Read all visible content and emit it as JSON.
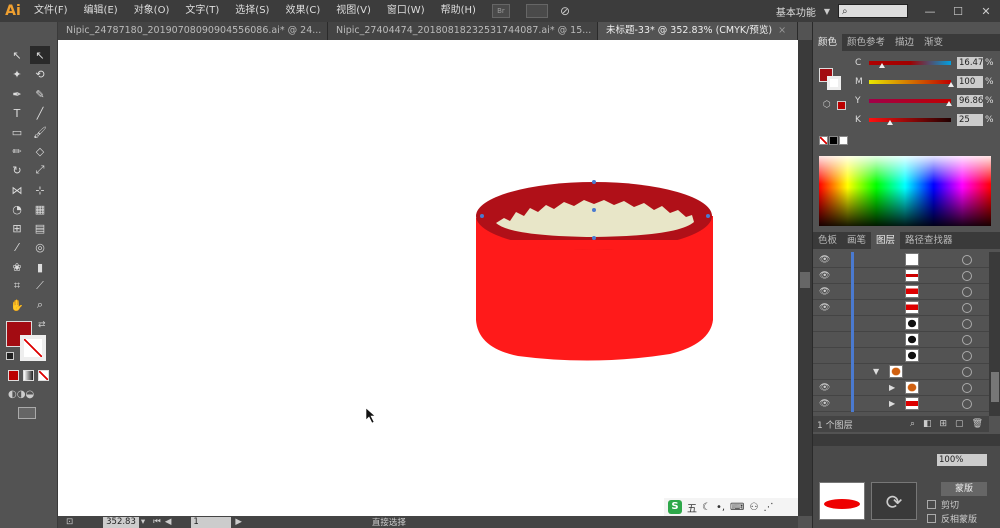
{
  "app": {
    "logo": "Ai"
  },
  "menu": {
    "items": [
      "文件(F)",
      "编辑(E)",
      "对象(O)",
      "文字(T)",
      "选择(S)",
      "效果(C)",
      "视图(V)",
      "窗口(W)",
      "帮助(H)"
    ],
    "br_label": "Br",
    "workspace": "基本功能",
    "search_placeholder": "",
    "search_icon": "search-icon"
  },
  "tabs": [
    {
      "label": "Nipic_24787180_20190708090904556086.ai* @ 24...",
      "active": false
    },
    {
      "label": "Nipic_27404474_20180818232531744087.ai* @ 15...",
      "active": false
    },
    {
      "label": "未标题-33* @ 352.83% (CMYK/预览)",
      "active": true
    }
  ],
  "status": {
    "zoom": "352.83",
    "page": "1",
    "tool_text": "直接选择"
  },
  "color_panel": {
    "tabs": [
      "颜色",
      "颜色参考",
      "描边",
      "渐变"
    ],
    "channels": [
      {
        "label": "C",
        "value": "16.47",
        "fraction": 0.16,
        "gradient": "linear-gradient(to right,#b00000,#a00000,#00a0e0)"
      },
      {
        "label": "M",
        "value": "100",
        "fraction": 1.0,
        "gradient": "linear-gradient(to right,#e8e800,#c00000)"
      },
      {
        "label": "Y",
        "value": "96.86",
        "fraction": 0.97,
        "gradient": "linear-gradient(to right,#a0004a,#c00000)"
      },
      {
        "label": "K",
        "value": "25",
        "fraction": 0.25,
        "gradient": "linear-gradient(to right,#ff1010,#200000)"
      }
    ],
    "fill_color": "#a30c12"
  },
  "layers_panel": {
    "tabs": [
      "色板",
      "画笔",
      "图层",
      "路径查找器"
    ],
    "footer": "1 个图层",
    "rows": [
      {
        "eye": true,
        "thumb": "white"
      },
      {
        "eye": true,
        "thumb": "stripe"
      },
      {
        "eye": true,
        "thumb": "red"
      },
      {
        "eye": true,
        "thumb": "red"
      },
      {
        "eye": false,
        "thumb": "dark"
      },
      {
        "eye": false,
        "thumb": "dark"
      },
      {
        "eye": false,
        "thumb": "dark"
      },
      {
        "eye": false,
        "thumb": "orange",
        "expanded": true
      },
      {
        "eye": true,
        "thumb": "orange"
      },
      {
        "eye": true,
        "thumb": "red"
      }
    ]
  },
  "lower_panel": {
    "labels": [
      "蒙版",
      "剪切",
      "反相蒙版"
    ],
    "pct": "100%"
  },
  "canvas": {
    "tub_color": "#ff1a1a",
    "rim_color": "#b01018",
    "rice_color": "#e8e6c8"
  }
}
